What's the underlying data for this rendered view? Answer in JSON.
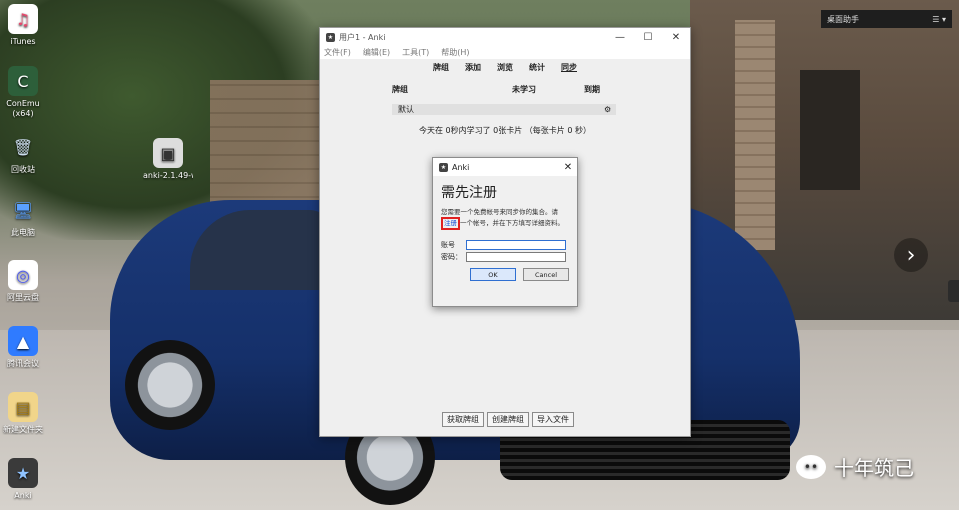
{
  "desktop": {
    "icons": [
      {
        "label": "iTunes",
        "glyph": "♫",
        "color": "#e8476c"
      },
      {
        "label": "ConEmu\n(x64)",
        "glyph": "C",
        "color": "#2d5f3a"
      },
      {
        "label": "回收站",
        "glyph": "🗑",
        "color": "#8aa6c9"
      },
      {
        "label": "此电脑",
        "glyph": "🖥",
        "color": "#2f7bd8"
      },
      {
        "label": "阿里云盘",
        "glyph": "◎",
        "color": "#4e5bf0"
      },
      {
        "label": "腾讯会议",
        "glyph": "▲",
        "color": "#2f7bff"
      },
      {
        "label": "新建文件夹",
        "glyph": "▤",
        "color": "#e9c46a"
      },
      {
        "label": "Anki",
        "glyph": "★",
        "color": "#3a3a3a"
      },
      {
        "label": "anki-2.1.49-windows....",
        "glyph": "▣",
        "color": "#6b6b6b"
      }
    ],
    "widget_label": "桌面助手",
    "watermark": "十年筑己"
  },
  "anki": {
    "window_title": "用户1 - Anki",
    "menu": [
      "文件(F)",
      "编辑(E)",
      "工具(T)",
      "帮助(H)"
    ],
    "toolbar": [
      "牌组",
      "添加",
      "浏览",
      "统计",
      "同步"
    ],
    "deck_header": {
      "col_deck": "牌组",
      "col_new": "未学习",
      "col_due": "到期"
    },
    "deck_rows": [
      {
        "name": "默认"
      }
    ],
    "study_info": "今天在 0秒内学习了 0张卡片 （每张卡片 0 秒）",
    "bottom_buttons": [
      "获取牌组",
      "创建牌组",
      "导入文件"
    ]
  },
  "dialog": {
    "title": "Anki",
    "heading": "需先注册",
    "desc_pre": "您需要一个免费帐号来同步你的集合。请",
    "register_link": "注册",
    "desc_post": "一个帐号，并在下方填写详细资料。",
    "account_label": "账号",
    "password_label": "密码：",
    "account_value": "",
    "password_value": "",
    "ok_label": "OK",
    "cancel_label": "Cancel"
  }
}
